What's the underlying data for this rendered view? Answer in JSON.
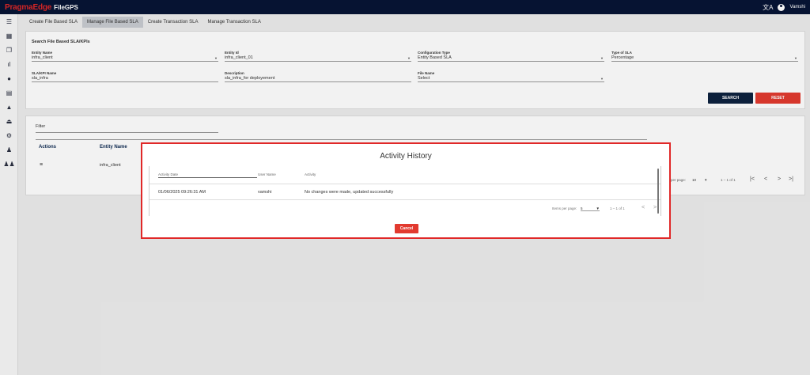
{
  "app": {
    "logo_main": "PragmaEdge",
    "logo_product": "FileGPS"
  },
  "topbar": {
    "translate_icon": "translate-icon",
    "user_icon": "account-circle-icon",
    "user_name": "Vamshi"
  },
  "sidebar": {
    "items": [
      "menu-icon",
      "dashboard-icon",
      "files-icon",
      "chart-icon",
      "user-icon",
      "document-icon",
      "bell-icon",
      "alarm-icon",
      "settings-icon",
      "user-settings-icon",
      "group-icon"
    ]
  },
  "tabs": [
    "Create File Based SLA",
    "Manage File Based SLA",
    "Create Transaction SLA",
    "Manage Transaction SLA"
  ],
  "active_tab": "Manage File Based SLA",
  "search": {
    "title": "Search File Based SLA/KPIs",
    "entity_name": {
      "label": "Entity Name",
      "value": "infra_client"
    },
    "entity_id": {
      "label": "Entity Id",
      "value": "infra_client_01"
    },
    "config_type": {
      "label": "Configuration Type",
      "value": "Entity Based SLA"
    },
    "sla_type": {
      "label": "Type of SLA",
      "value": "Percentage"
    },
    "sla_kpi_name": {
      "label": "SLA/KPI Name",
      "value": "sla_infra"
    },
    "description": {
      "label": "Description",
      "value": "sla_infra_for deployement"
    },
    "file_name": {
      "label": "File Name",
      "value": "Select"
    },
    "search_label": "SEARCH",
    "reset_label": "RESET"
  },
  "results": {
    "filter_placeholder": "Filter",
    "headers": [
      "Actions",
      "Entity Name"
    ],
    "row_entity": "infra_client",
    "items_per_page_label": "per page:",
    "items_per_page_value": "10",
    "range": "1 – 1 of 1",
    "nav": [
      "|<",
      "<",
      ">",
      ">|"
    ]
  },
  "modal": {
    "title": "Activity History",
    "headers": [
      "Activity Date",
      "User Name",
      "Activity"
    ],
    "rows": [
      {
        "date": "01/06/2025 09:26:31 AM",
        "user": "vamshi",
        "activity": "No changes were made, updated successfully"
      }
    ],
    "items_per_page_label": "Items per page:",
    "items_per_page_value": "5",
    "range": "1 – 1 of 1",
    "prev": "<",
    "next": ">",
    "cancel_label": "Cancel"
  },
  "colors": {
    "topbar": "#071535",
    "brand_red": "#e02828",
    "search_btn": "#0d2240",
    "reset_btn": "#e23a2f"
  }
}
